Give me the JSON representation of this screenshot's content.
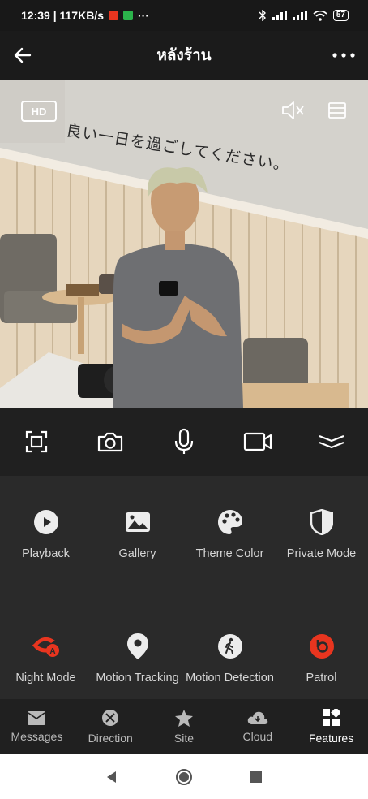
{
  "status_bar": {
    "time_speed": "12:39 | 117KB/s",
    "battery": "57",
    "dots": "···"
  },
  "header": {
    "title": "หลังร้าน",
    "back_icon": "arrow-left-icon",
    "more_icon": "more-horizontal-icon"
  },
  "video": {
    "quality_badge": "HD",
    "wall_text": "良い一日を過ごしてください。",
    "mute_icon": "speaker-muted-icon",
    "layout_icon": "layout-icon"
  },
  "controls": [
    "fullscreen-icon",
    "camera-icon",
    "microphone-icon",
    "video-record-icon",
    "collapse-icon"
  ],
  "features": [
    {
      "label": "Playback",
      "icon": "play-circle-icon"
    },
    {
      "label": "Gallery",
      "icon": "gallery-icon"
    },
    {
      "label": "Theme Color",
      "icon": "palette-icon"
    },
    {
      "label": "Private Mode",
      "icon": "shield-icon"
    },
    {
      "label": "Night Mode",
      "icon": "night-mode-icon"
    },
    {
      "label": "Motion Tracking",
      "icon": "location-pin-icon"
    },
    {
      "label": "Motion Detection",
      "icon": "walking-person-icon"
    },
    {
      "label": "Patrol",
      "icon": "patrol-icon"
    }
  ],
  "bottom_nav": [
    {
      "label": "Messages",
      "icon": "envelope-icon"
    },
    {
      "label": "Direction",
      "icon": "direction-icon"
    },
    {
      "label": "Site",
      "icon": "star-icon"
    },
    {
      "label": "Cloud",
      "icon": "cloud-icon"
    },
    {
      "label": "Features",
      "icon": "grid-icon"
    }
  ],
  "active_nav": "Features",
  "colors": {
    "accent": "#e8351f",
    "background": "#2a2a2a",
    "text": "#d6d6d6"
  }
}
